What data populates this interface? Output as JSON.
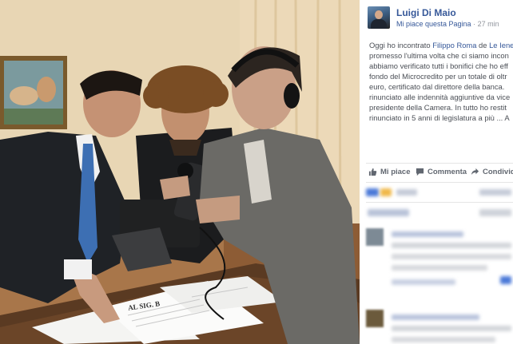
{
  "post": {
    "author": "Luigi Di Maio",
    "like_page": "Mi piace questa Pagina",
    "separator": " · ",
    "time": "27 min",
    "text": {
      "l1_a": "Oggi ho incontrato ",
      "l1_mention1": "Filippo Roma",
      "l1_b": " de ",
      "l1_mention2": "Le Iene",
      "l2": "promesso l'ultima volta che ci siamo incon",
      "l3": "abbiamo verificato tutti i bonifici che ho eff",
      "l4": "fondo del Microcredito per un totale di oltr",
      "l5": "euro, certificato dal direttore della banca.",
      "l6": "rinunciato alle indennità aggiuntive da vice",
      "l7": "presidente della Camera. In tutto ho restit",
      "l8": "rinunciato in 5 anni di legislatura a più ... A"
    },
    "actions": {
      "like": "Mi piace",
      "comment": "Commenta",
      "share": "Condividi"
    }
  },
  "photo": {
    "document_caption": "AL SIG. B"
  },
  "colors": {
    "link": "#365899",
    "meta": "#90949c",
    "text": "#4b4f56",
    "action": "#616770"
  },
  "icons": {
    "like": "thumbs-up-icon",
    "comment": "speech-bubble-icon",
    "share": "share-arrow-icon"
  }
}
